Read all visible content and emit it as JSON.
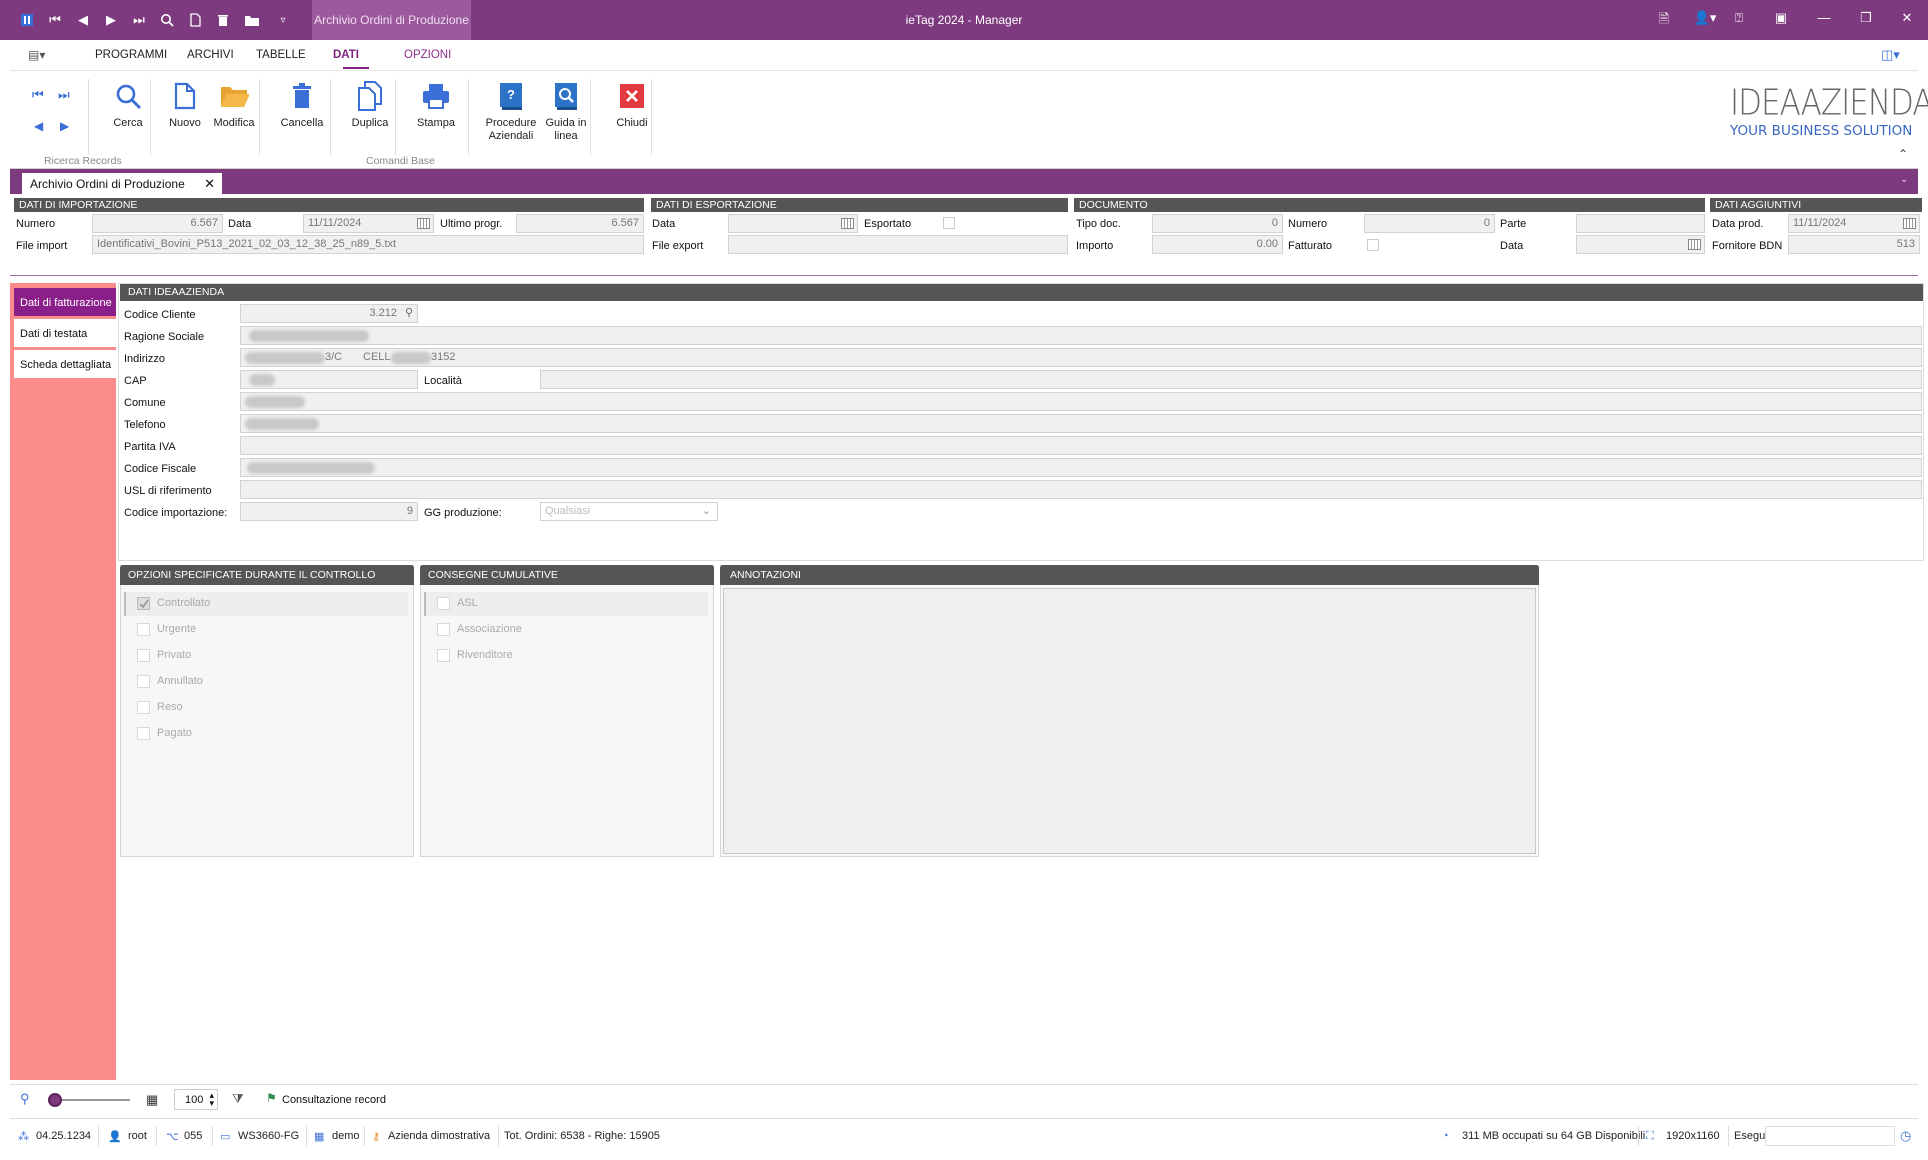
{
  "titlebar": {
    "document_tab": "Archivio Ordini di Produzione",
    "app_title": "ieTag 2024 - Manager"
  },
  "menu": [
    "PROGRAMMI",
    "ARCHIVI",
    "TABELLE",
    "DATI",
    "OPZIONI"
  ],
  "ribbon": {
    "cerca": "Cerca",
    "ricerca_records": "Ricerca Records",
    "nuovo": "Nuovo",
    "modifica": "Modifica",
    "cancella": "Cancella",
    "duplica": "Duplica",
    "stampa": "Stampa",
    "procedure_1": "Procedure",
    "procedure_2": "Aziendali",
    "guida_1": "Guida in",
    "guida_2": "linea",
    "chiudi": "Chiudi",
    "comandi_base": "Comandi Base",
    "logo_text": "IDEAAZIENDA",
    "logo_tagline": "YOUR BUSINESS SOLUTION"
  },
  "form_tab": "Archivio Ordini di Produzione",
  "importazione": {
    "header": "DATI DI IMPORTAZIONE",
    "numero_label": "Numero",
    "numero": "6.567",
    "data_label": "Data",
    "data": "11/11/2024",
    "ultimo_label": "Ultimo progr.",
    "ultimo": "6.567",
    "file_label": "File import",
    "file": "Identificativi_Bovini_P513_2021_02_03_12_38_25_n89_5.txt"
  },
  "esportazione": {
    "header": "DATI DI ESPORTAZIONE",
    "data_label": "Data",
    "esportato_label": "Esportato",
    "file_label": "File export"
  },
  "documento": {
    "header": "DOCUMENTO",
    "tipo_label": "Tipo doc.",
    "tipo": "0",
    "numero_label": "Numero",
    "numero": "0",
    "parte_label": "Parte",
    "importo_label": "Importo",
    "importo": "0.00",
    "fatturato_label": "Fatturato",
    "data_label": "Data"
  },
  "aggiuntivi": {
    "header": "DATI AGGIUNTIVI",
    "data_prod_label": "Data prod.",
    "data_prod": "11/11/2024",
    "fornitore_label": "Fornitore BDN",
    "fornitore": "513"
  },
  "left_tabs": [
    "Dati di fatturazione",
    "Dati di testata",
    "Scheda dettagliata"
  ],
  "ideaazienda": {
    "header": "DATI IDEAAZIENDA",
    "codice_cliente_label": "Codice Cliente",
    "codice_cliente": "3.212",
    "ragione_label": "Ragione Sociale",
    "indirizzo_label": "Indirizzo",
    "indirizzo_frag1": "3/C",
    "indirizzo_frag2": "CELL",
    "indirizzo_frag3": "3152",
    "cap_label": "CAP",
    "localita_label": "Località",
    "comune_label": "Comune",
    "telefono_label": "Telefono",
    "piva_label": "Partita IVA",
    "cf_label": "Codice Fiscale",
    "usl_label": "USL di riferimento",
    "cod_imp_label": "Codice importazione:",
    "cod_imp": "9",
    "gg_label": "GG produzione:",
    "gg_value": "Qualsiasi"
  },
  "opzioni": {
    "header": "OPZIONI SPECIFICATE DURANTE IL CONTROLLO",
    "items": [
      "Controllato",
      "Urgente",
      "Privato",
      "Annullato",
      "Reso",
      "Pagato"
    ]
  },
  "consegne": {
    "header": "CONSEGNE CUMULATIVE",
    "items": [
      "ASL",
      "Associazione",
      "Rivenditore"
    ]
  },
  "annotazioni": {
    "header": "ANNOTAZIONI"
  },
  "toolbar2": {
    "page_size": "100",
    "status": "Consultazione record"
  },
  "statusbar": {
    "version": "04.25.1234",
    "user": "root",
    "code": "055",
    "workstation": "WS3660-FG",
    "db": "demo",
    "company": "Azienda dimostrativa",
    "totals": "Tot. Ordini: 6538 - Righe: 15905",
    "memory": "311 MB occupati su 64 GB Disponibili",
    "resolution": "1920x1160",
    "esegui": "Esegui"
  },
  "colors": {
    "accent": "#7e3a7e",
    "left_panel": "#fc8c8c",
    "active_tab": "#8a1f8a",
    "section_header": "#555555"
  }
}
